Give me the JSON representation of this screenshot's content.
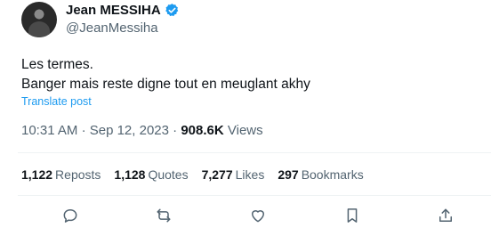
{
  "author": {
    "name": "Jean MESSIHA",
    "handle": "@JeanMessiha",
    "verified": true,
    "badge_color": "#1d9bf0"
  },
  "tweet": {
    "line1": "Les termes.",
    "line2": "Banger mais reste digne tout en meuglant akhy",
    "translate_label": "Translate post"
  },
  "meta": {
    "time": "10:31 AM",
    "separator": "·",
    "date": "Sep 12, 2023",
    "views_count": "908.6K",
    "views_label": "Views"
  },
  "stats": {
    "reposts_count": "1,122",
    "reposts_label": "Reposts",
    "quotes_count": "1,128",
    "quotes_label": "Quotes",
    "likes_count": "7,277",
    "likes_label": "Likes",
    "bookmarks_count": "297",
    "bookmarks_label": "Bookmarks"
  },
  "actions": {
    "icons": [
      "reply-icon",
      "repost-icon",
      "like-icon",
      "bookmark-icon",
      "share-icon"
    ]
  }
}
